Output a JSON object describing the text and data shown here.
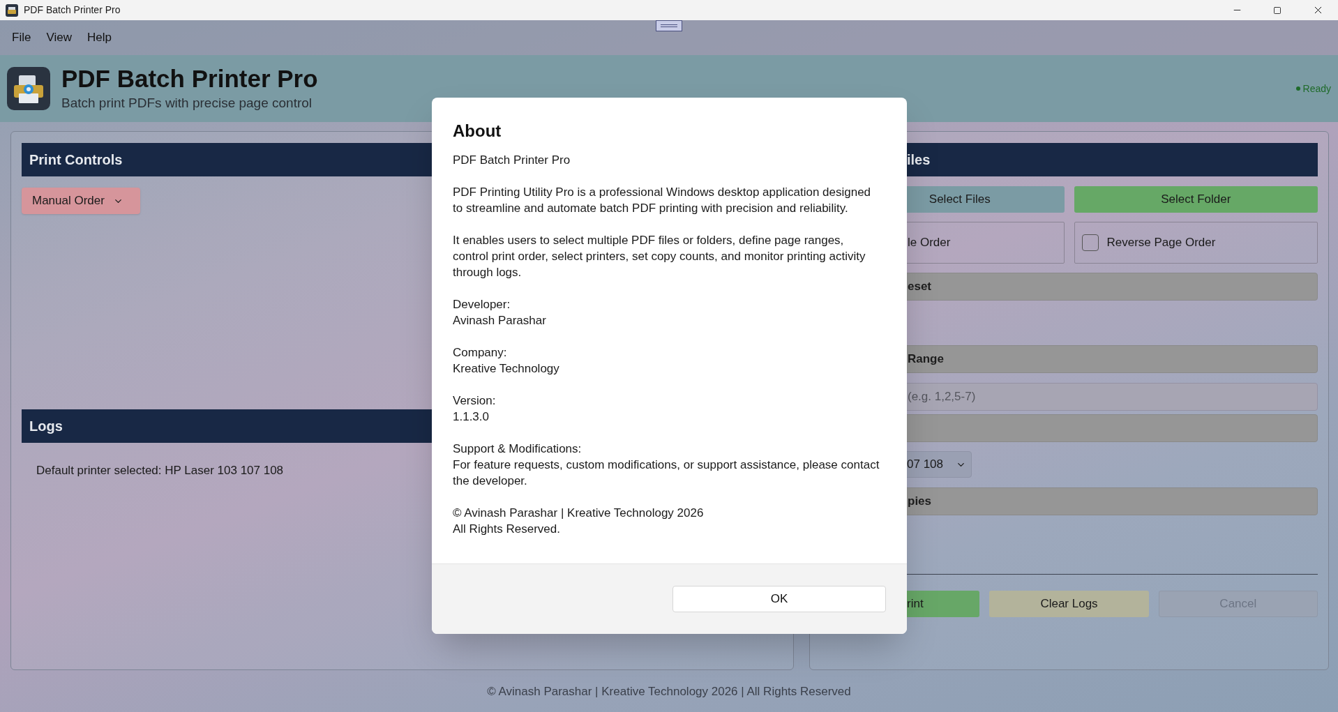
{
  "window": {
    "title": "PDF Batch Printer Pro"
  },
  "menu": [
    "File",
    "View",
    "Help"
  ],
  "header": {
    "title": "PDF Batch Printer Pro",
    "subtitle": "Batch print PDFs with precise page control",
    "status": "Ready"
  },
  "print_controls": {
    "title": "Print Controls",
    "order_dropdown": "Manual Order"
  },
  "logs": {
    "title": "Logs",
    "entries": [
      "Default printer selected: HP Laser 103 107 108"
    ]
  },
  "files_panel": {
    "title": "iles",
    "select_files": "Select Files",
    "select_folder": "Select Folder",
    "order_option": {
      "label": "le Order"
    },
    "reverse_page_order": {
      "label": "Reverse Page Order",
      "checked": false
    },
    "preset_header": "eset",
    "range_header": "Range",
    "range_input": {
      "placeholder": "(e.g. 1,2,5-7)"
    },
    "printer_dropdown": "07 108",
    "copies_header": "pies",
    "buttons": [
      {
        "label": "rint",
        "kind": "print",
        "disabled": false
      },
      {
        "label": "Clear Logs",
        "kind": "clear",
        "disabled": false
      },
      {
        "label": "Cancel",
        "kind": "cancel",
        "disabled": true
      }
    ]
  },
  "footer": "© Avinash Parashar | Kreative Technology 2026 | All Rights Reserved",
  "dialog": {
    "title": "About",
    "paragraphs": [
      "PDF Batch Printer Pro",
      "PDF Printing Utility Pro is a professional Windows desktop application designed to streamline and automate batch PDF printing with precision and reliability.",
      "It enables users to select multiple PDF files or folders, define page ranges, control print order, select printers, set copy counts, and monitor printing activity through logs.",
      "Developer:\nAvinash Parashar",
      "Company:\nKreative Technology",
      "Version:\n1.1.3.0",
      "Support & Modifications:\nFor feature requests, custom modifications, or support assistance, please contact the developer.",
      "© Avinash Parashar | Kreative Technology 2026\nAll Rights Reserved."
    ],
    "ok": "OK"
  }
}
